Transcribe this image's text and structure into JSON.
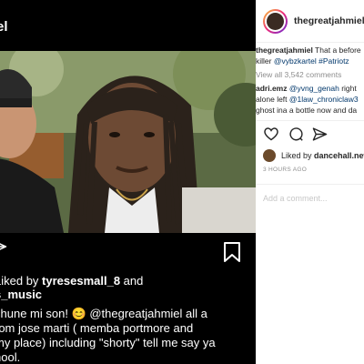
{
  "left_panel": {
    "username_fragment": "el",
    "liked_by_prefix": "Liked by ",
    "liked_by_user": "tyresesmall_8",
    "liked_by_suffix": " and",
    "liked_by_line2": "s_music",
    "caption_lines": [
      "chune mi son! 😊 @thegreatjahmiel all a",
      "rom jose marti ( memba portmore and",
      "my place) including \"shorty\" tell me say ya",
      "hool."
    ]
  },
  "post": {
    "username": "thegreatjahmiel",
    "verified_badge": "✓",
    "comments": [
      {
        "user": "thegreatjahmiel",
        "lines": [
          "That a before",
          "killer @vybzkartel #Patriotz"
        ]
      },
      {
        "view_all": "View all 3,542 comments"
      },
      {
        "user": "adri.emz",
        "lines": [
          "@yvng_genah right",
          "alone left @1law_chroniclaw3",
          "ghost ina a bottle now and da"
        ]
      }
    ],
    "liked_by_prefix": "Liked by ",
    "liked_by_user": "dancehall.new",
    "time_ago": "3 HOURS AGO",
    "add_comment_placeholder": "Add a comment..."
  },
  "icons": {
    "like": "heart-icon",
    "comment": "comment-icon",
    "share": "paper-plane-icon",
    "save": "bookmark-icon",
    "verified": "verified-badge-icon"
  },
  "colors": {
    "link": "#00376b",
    "muted": "#8e8e8e",
    "verified": "#3897f0",
    "avatar_ring_start": "#f9ce34",
    "avatar_ring_end": "#6228d7"
  }
}
